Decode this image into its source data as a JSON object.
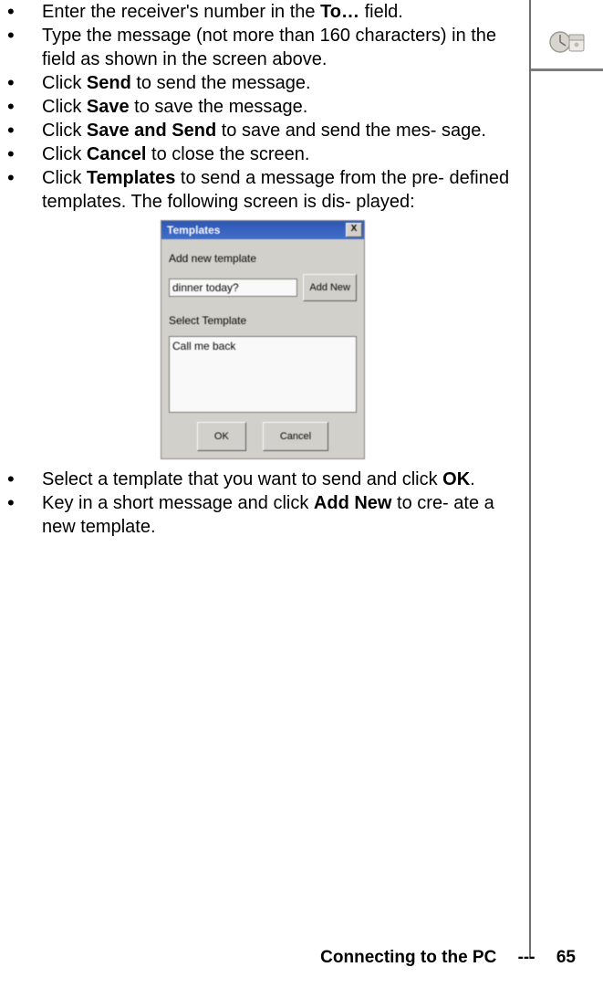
{
  "bullets": {
    "b1_a": "Enter the receiver's number in the ",
    "b1_bold": "To…",
    "b1_c": " field.",
    "b2": "Type the message (not more than 160 characters) in the field as shown in the screen above.",
    "b3_a": "Click ",
    "b3_bold": "Send",
    "b3_c": " to send the message.",
    "b4_a": "Click ",
    "b4_bold": "Save",
    "b4_c": " to save the message.",
    "b5_a": "Click ",
    "b5_bold": "Save and Send",
    "b5_c": " to save and send the mes- sage.",
    "b6_a": "Click ",
    "b6_bold": "Cancel",
    "b6_c": " to close the screen.",
    "b7_a": "Click ",
    "b7_bold": "Templates",
    "b7_c": " to send a message from the pre- defined templates. The following screen is dis- played:",
    "b8_a": "Select a template that you want to send and click ",
    "b8_bold": "OK",
    "b8_c": ".",
    "b9_a": "Key in a short message and click ",
    "b9_bold": "Add New",
    "b9_c": " to cre- ate a new template."
  },
  "dialog": {
    "title": "Templates",
    "close": "X",
    "add_label": "Add new template",
    "input_value": "dinner today?",
    "add_btn": "Add New",
    "select_label": "Select Template",
    "list_item": "Call me back",
    "ok": "OK",
    "cancel": "Cancel"
  },
  "footer": {
    "section": "Connecting to the PC",
    "sep": "---",
    "page": "65"
  },
  "dot": "•"
}
